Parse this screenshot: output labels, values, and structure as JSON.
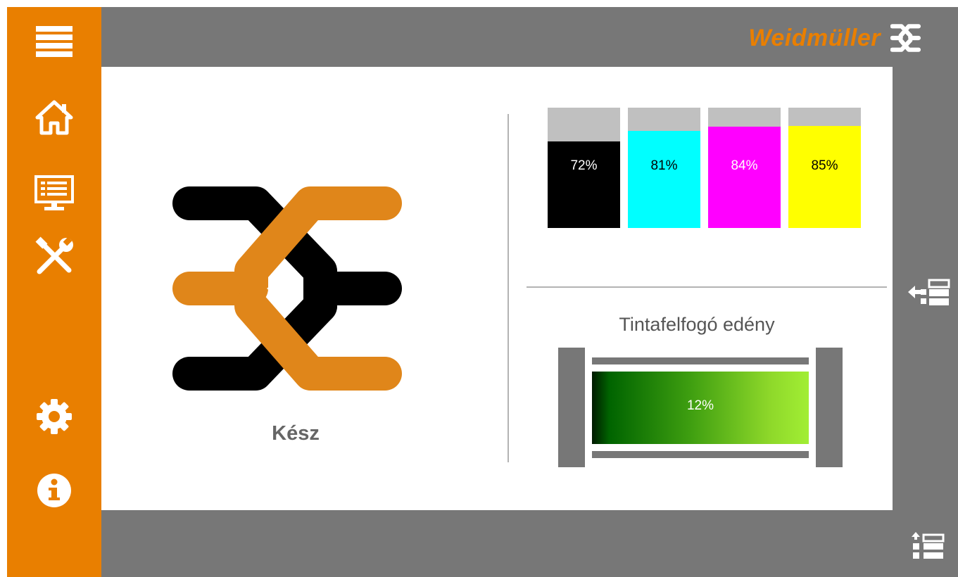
{
  "header": {
    "brand_name": "Weidmüller"
  },
  "sidebar": {
    "items": [
      {
        "name": "menu",
        "icon": "hamburger-menu-icon"
      },
      {
        "name": "home",
        "icon": "home-icon"
      },
      {
        "name": "monitor",
        "icon": "monitor-list-icon"
      },
      {
        "name": "tools",
        "icon": "tools-icon"
      },
      {
        "name": "settings",
        "icon": "gear-icon"
      },
      {
        "name": "info",
        "icon": "info-icon"
      }
    ]
  },
  "printer": {
    "status": "Kész"
  },
  "ink_levels": [
    {
      "color": "#000000",
      "level": 72,
      "label": "72%",
      "text_color": "#ffffff"
    },
    {
      "color": "#00ffff",
      "level": 81,
      "label": "81%",
      "text_color": "#000000"
    },
    {
      "color": "#ff00ff",
      "level": 84,
      "label": "84%",
      "text_color": "#ffffff"
    },
    {
      "color": "#ffff00",
      "level": 85,
      "label": "85%",
      "text_color": "#000000"
    }
  ],
  "waste_tank": {
    "title": "Tintafelfogó edény",
    "level": 12,
    "label": "12%"
  },
  "right_panel": {
    "buttons": [
      {
        "name": "collapse-list",
        "icon": "arrow-left-list-icon"
      },
      {
        "name": "expand-list",
        "icon": "arrow-up-list-icon"
      }
    ]
  },
  "colors": {
    "accent": "#e97f00",
    "frame": "#777777",
    "logo_orange": "#e0861a",
    "logo_black": "#000000"
  }
}
